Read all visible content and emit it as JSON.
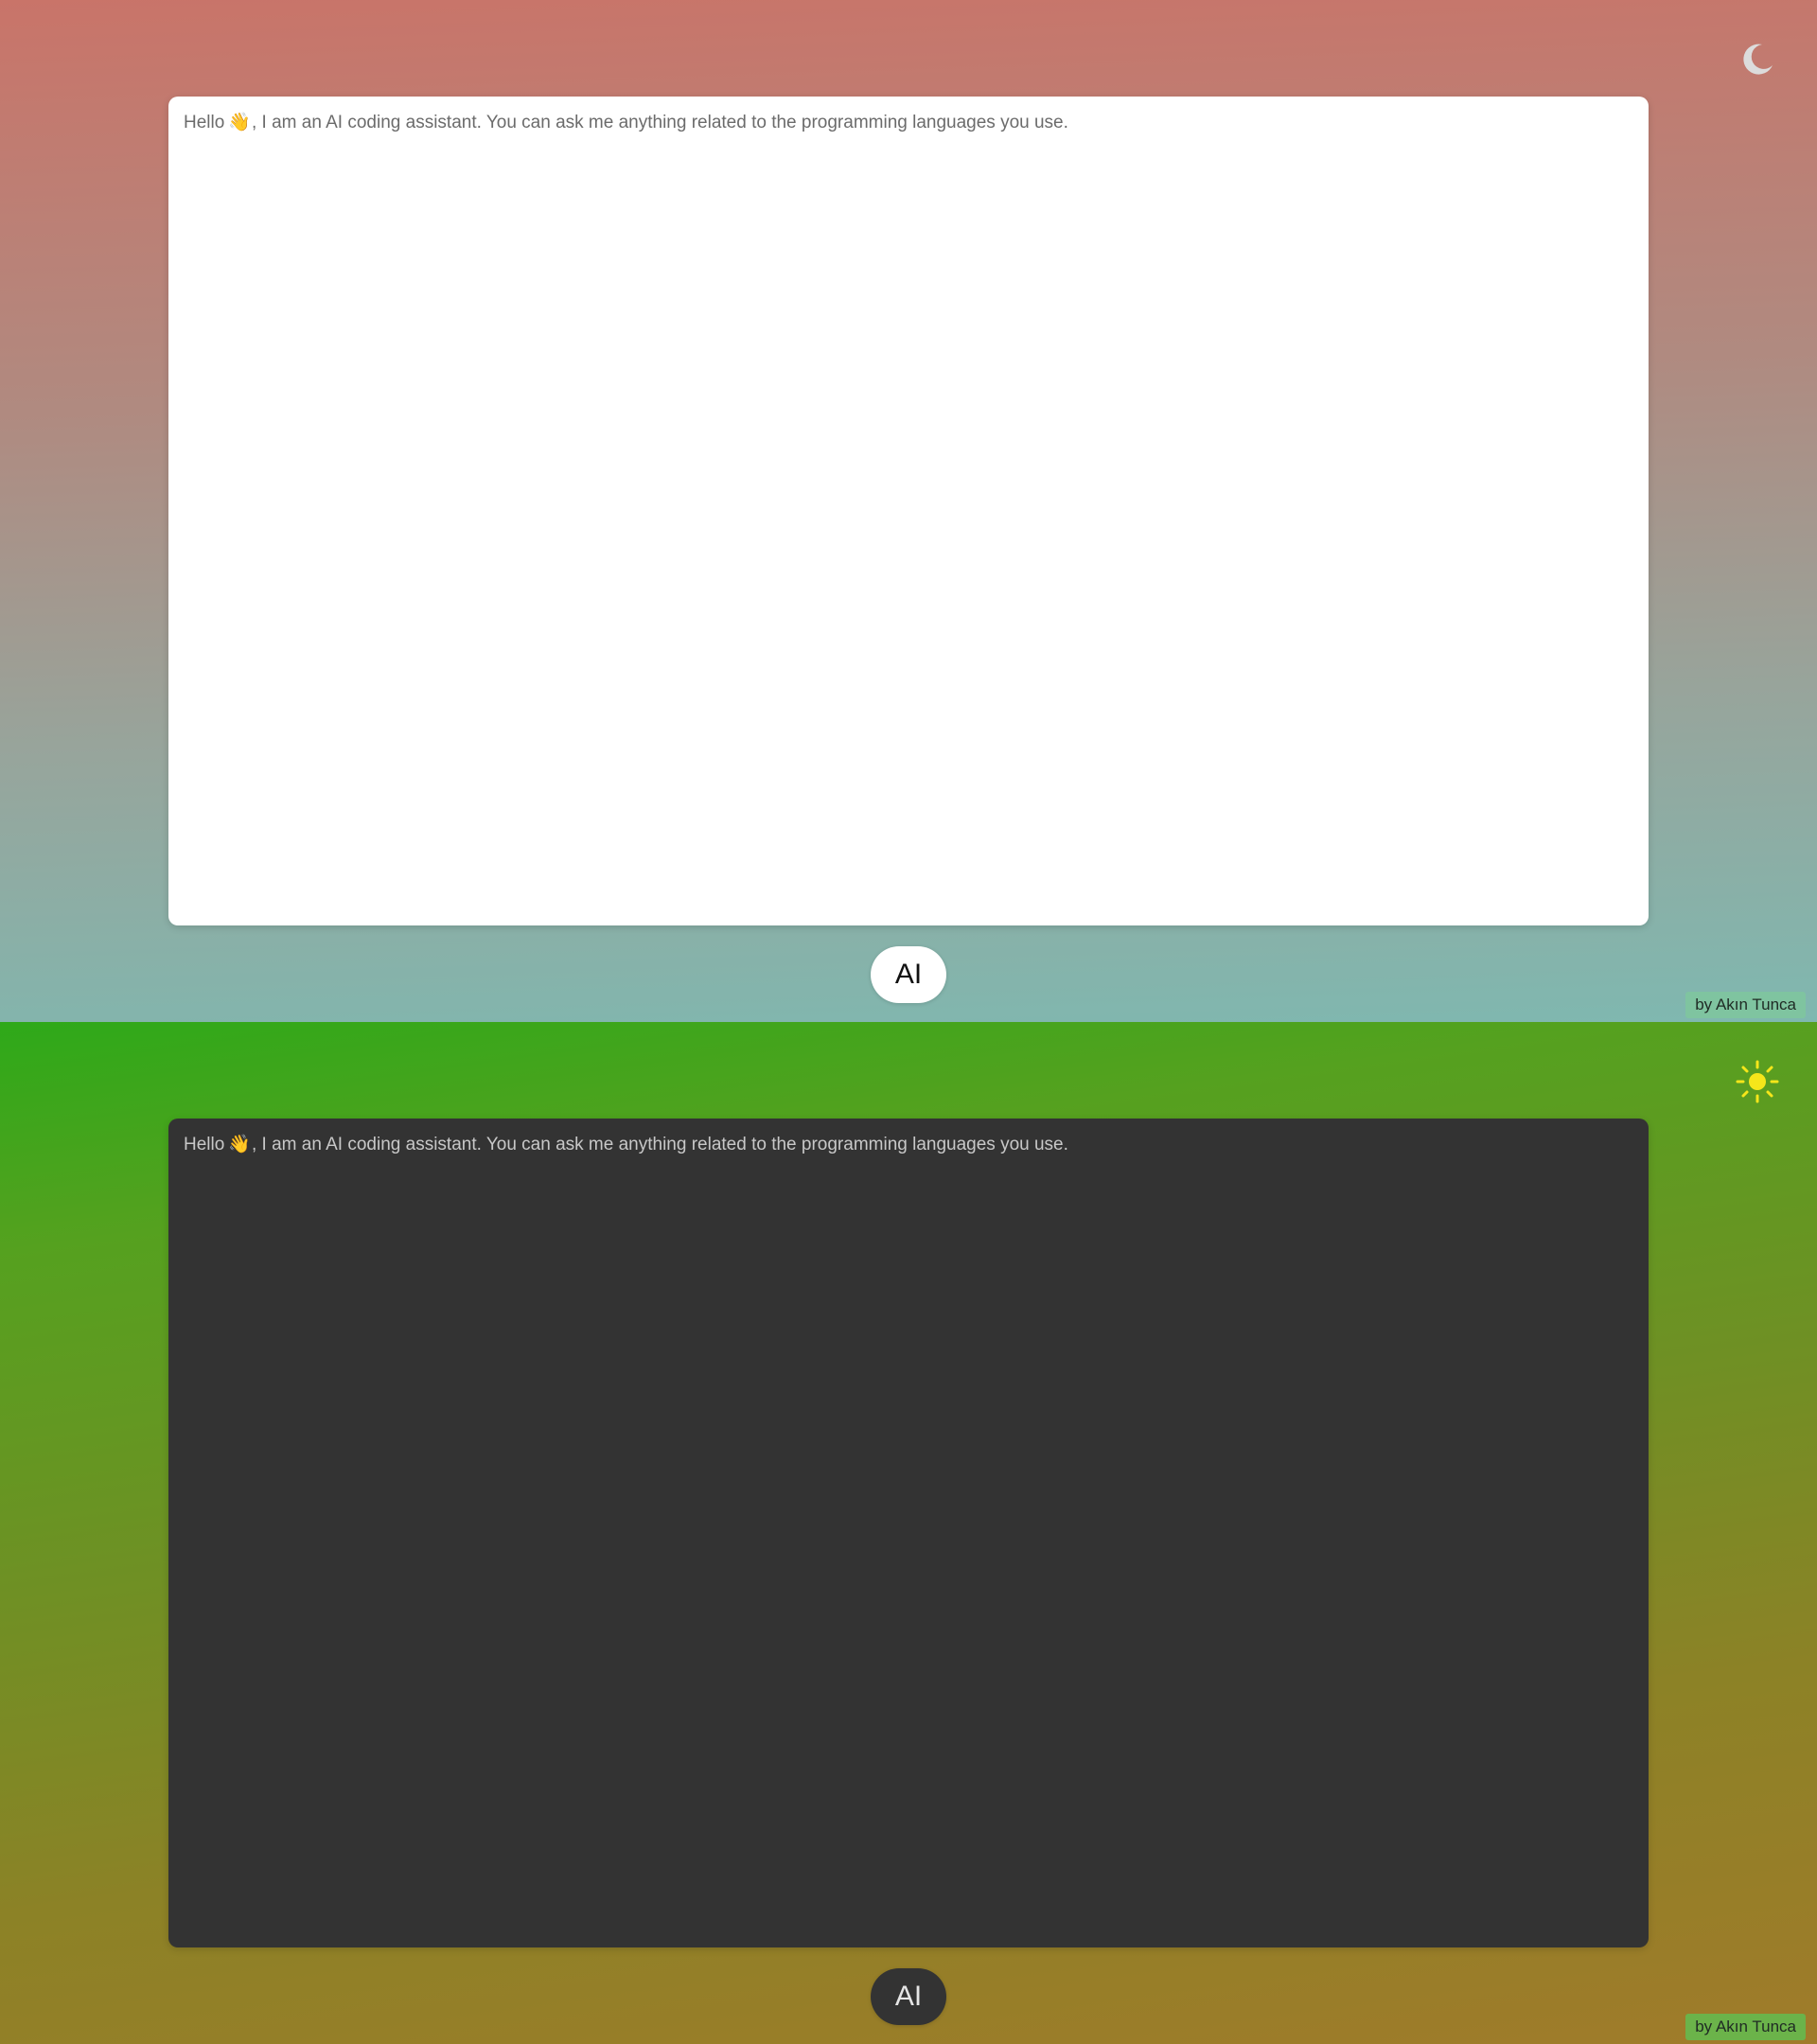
{
  "light_panel": {
    "theme_icon": "moon-icon",
    "chat_message": {
      "prefix": "Hello",
      "emoji": "👋",
      "text": ", I am an AI coding assistant. You can ask me anything related to the programming languages you use."
    },
    "ai_button_label": "AI",
    "credit": "by Akın Tunca"
  },
  "dark_panel": {
    "theme_icon": "sun-icon",
    "chat_message": {
      "prefix": "Hello",
      "emoji": "👋",
      "text": ", I am an AI coding assistant. You can ask me anything related to the programming languages you use."
    },
    "ai_button_label": "AI",
    "credit": "by Akın Tunca"
  },
  "colors": {
    "light_bg_top": "#c97469",
    "light_bg_bottom": "#7fb8b0",
    "dark_bg_top": "#2ea919",
    "dark_bg_bottom": "#a07b2a",
    "sun": "#f5e61a",
    "moon": "#d9d9d9"
  }
}
